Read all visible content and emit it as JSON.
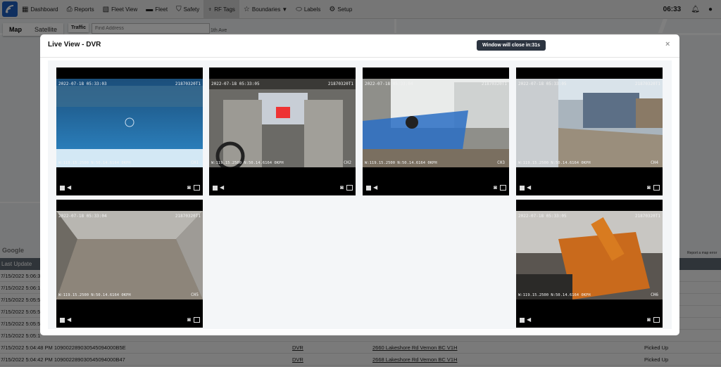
{
  "nav": {
    "items": [
      {
        "label": "Dashboard",
        "icon": "grid-icon"
      },
      {
        "label": "Reports",
        "icon": "printer-icon"
      },
      {
        "label": "Fleet View",
        "icon": "map-icon"
      },
      {
        "label": "Fleet",
        "icon": "car-icon"
      },
      {
        "label": "Safety",
        "icon": "shield-icon"
      },
      {
        "label": "RF Tags",
        "icon": "antenna-icon"
      },
      {
        "label": "Boundaries",
        "icon": "star-icon"
      },
      {
        "label": "Labels",
        "icon": "tag-icon"
      },
      {
        "label": "Setup",
        "icon": "gear-icon"
      }
    ],
    "active": "RF Tags",
    "clock": "06:33"
  },
  "map": {
    "map_tab": "Map",
    "satellite_tab": "Satellite",
    "traffic": "Traffic",
    "address_placeholder": "Find Address",
    "street": "1th Ave",
    "google": "Google",
    "report_error": "Report a map error"
  },
  "table": {
    "header": "Last Update",
    "rows": [
      {
        "c1": "7/15/2022 5:06:3",
        "c2": "",
        "c3": "",
        "c4": ""
      },
      {
        "c1": "7/15/2022 5:06:1",
        "c2": "",
        "c3": "",
        "c4": ""
      },
      {
        "c1": "7/15/2022 5:05:5",
        "c2": "",
        "c3": "",
        "c4": ""
      },
      {
        "c1": "7/15/2022 5:05:5",
        "c2": "",
        "c3": "",
        "c4": ""
      },
      {
        "c1": "7/15/2022 5:05:5",
        "c2": "",
        "c3": "",
        "c4": ""
      },
      {
        "c1": "7/15/2022 5:05:1",
        "c2": "",
        "c3": "",
        "c4": ""
      },
      {
        "c1": "7/15/2022 5:04:48 PM 109002289030545094000B5E",
        "c2": "DVR",
        "c3": "2660 Lakeshore Rd Vernon BC V1H",
        "c4": "Picked Up"
      },
      {
        "c1": "7/15/2022 5:04:42 PM 109002289030545094000B47",
        "c2": "DVR",
        "c3": "2668 Lakeshore Rd Vernon BC V1H",
        "c4": "Picked Up"
      }
    ]
  },
  "modal": {
    "title": "Live View - DVR",
    "timer": "Window will close in:31s",
    "close": "×",
    "cameras": [
      {
        "stamp": "2022-07-18 05:33:03",
        "device": "21870320T1",
        "gps": "W:119.15.2500 N:50.14.6164 0KPH",
        "channel": "CH1"
      },
      {
        "stamp": "2022-07-18 05:33:05",
        "device": "21870320T1",
        "gps": "W:119.15.2500 N:50.14.6164 0KPH",
        "channel": "CH2"
      },
      {
        "stamp": "2022-07-18 05:33:04",
        "device": "21870320T1",
        "gps": "W:119.15.2500 N:50.14.6164 0KPH",
        "channel": "CH3"
      },
      {
        "stamp": "2022-07-18 05:33:05",
        "device": "21870320T1",
        "gps": "W:119.15.2500 N:50.14.6164 0KPH",
        "channel": "CH4"
      },
      {
        "stamp": "2022-07-18 05:33:04",
        "device": "21870320T1",
        "gps": "W:119.15.2500 N:50.14.6164 0KPH",
        "channel": "CH5"
      },
      {
        "stamp": "2022-07-18 05:33:05",
        "device": "21870320T1",
        "gps": "W:119.15.2500 N:50.14.6164 0KPH",
        "channel": "CH6"
      }
    ]
  }
}
